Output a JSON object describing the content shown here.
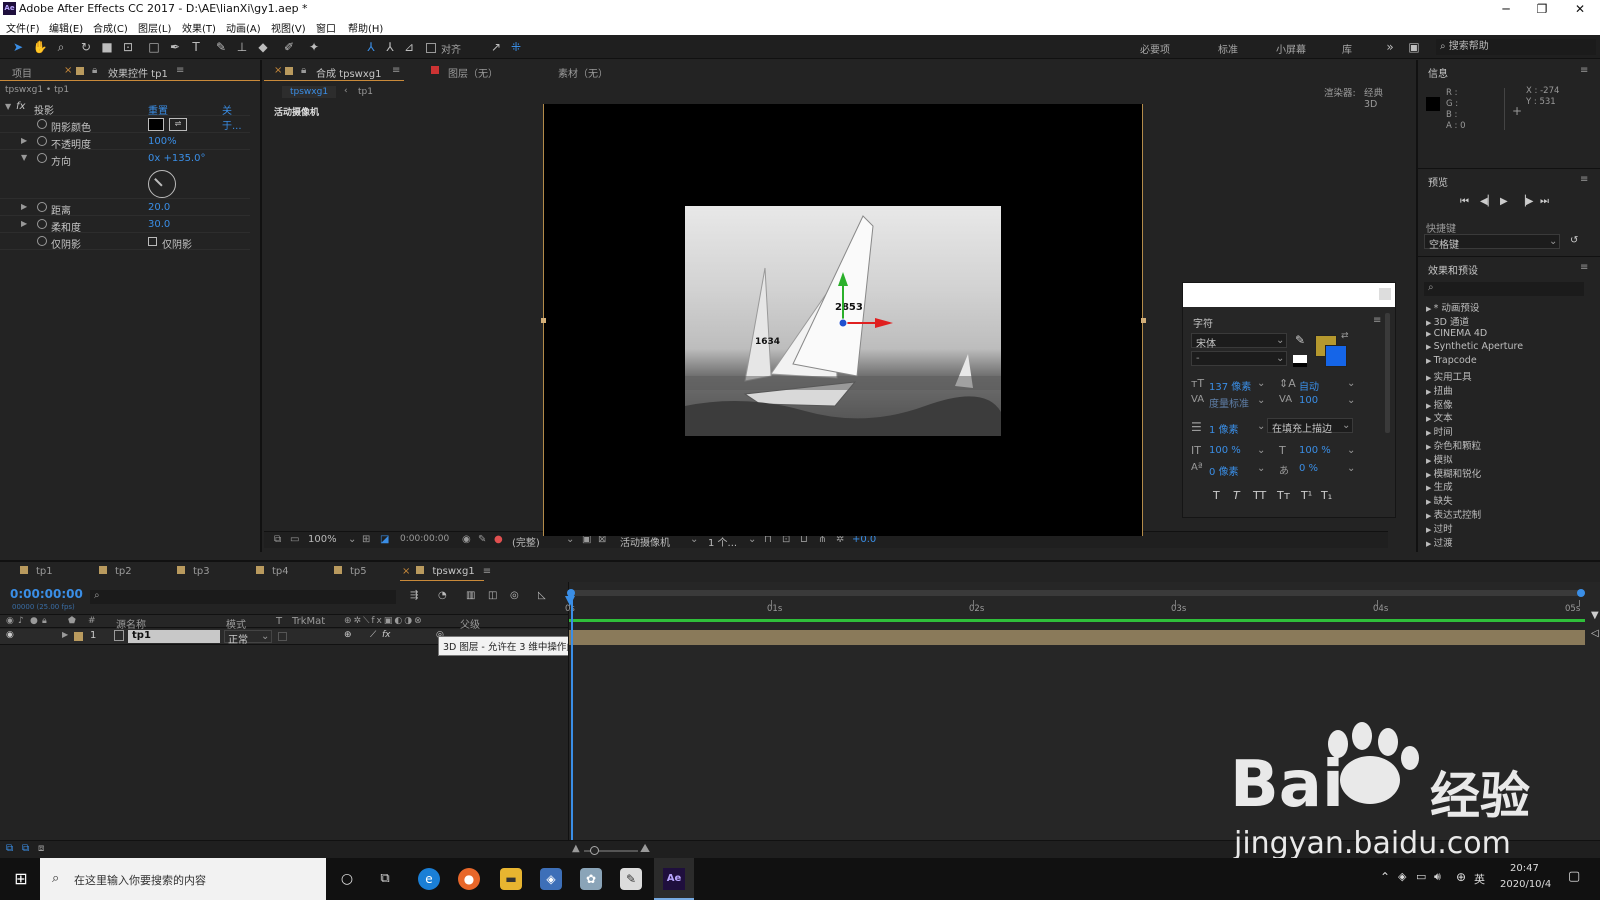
{
  "window": {
    "title": "Adobe After Effects CC 2017 - D:\\AE\\lianXi\\gy1.aep *",
    "logo": "Ae"
  },
  "menu": [
    "文件(F)",
    "编辑(E)",
    "合成(C)",
    "图层(L)",
    "效果(T)",
    "动画(A)",
    "视图(V)",
    "窗口",
    "帮助(H)"
  ],
  "toolbar": {
    "align_label": "对齐",
    "workspaces": [
      "必要项",
      "标准",
      "小屏幕",
      "库"
    ],
    "search_help": "搜索帮助"
  },
  "left_panel": {
    "tabs": [
      "项目",
      "效果控件 tp1"
    ],
    "breadcrumb": "tpswxg1 • tp1",
    "effect": {
      "name": "投影",
      "reset": "重置",
      "about": "关于..."
    },
    "properties": [
      {
        "name": "阴影颜色",
        "value": ""
      },
      {
        "name": "不透明度",
        "value": "100%"
      },
      {
        "name": "方向",
        "value": "0x +135.0°"
      },
      {
        "name": "距离",
        "value": "20.0"
      },
      {
        "name": "柔和度",
        "value": "30.0"
      },
      {
        "name": "仅阴影",
        "value": "仅阴影"
      }
    ]
  },
  "comp_panel": {
    "tabs": [
      "合成 tpswxg1",
      "图层（无）",
      "素材（无）"
    ],
    "subtabs": [
      "tpswxg1",
      "tp1"
    ],
    "renderer_label": "渲染器:",
    "renderer_value": "经典 3D",
    "camera_label": "活动摄像机",
    "footer": {
      "zoom": "100%",
      "timecode": "0:00:00:00",
      "resolution": "(完整)",
      "camera": "活动摄像机",
      "views": "1 个...",
      "exposure": "+0.0"
    },
    "boat_numbers": [
      "2853",
      "1634"
    ]
  },
  "char_panel": {
    "title": "字符",
    "font": "宋体",
    "font_style": "-",
    "size": "137 像素",
    "leading": "自动",
    "kerning": "度量标准",
    "tracking": "100",
    "stroke": "1 像素",
    "stroke_mode": "在填充上描边",
    "vscale": "100 %",
    "hscale": "100 %",
    "baseline": "0 像素",
    "tsume": "0 %",
    "fill_color": "#b5982e",
    "stroke_color": "#1565e8",
    "styles": [
      "T",
      "T",
      "TT",
      "Tт",
      "T¹",
      "T₁"
    ]
  },
  "right_panel": {
    "info_title": "信息",
    "rgba": [
      "R :",
      "G :",
      "B :",
      "A : 0"
    ],
    "xy": [
      "X : -274",
      "Y : 531"
    ],
    "preview_title": "预览",
    "shortcut_label": "快捷键",
    "shortcut_value": "空格键",
    "effects_title": "效果和预设",
    "effects": [
      "* 动画预设",
      "3D 通道",
      "CINEMA 4D",
      "Synthetic Aperture",
      "Trapcode",
      "实用工具",
      "扭曲",
      "抠像",
      "文本",
      "时间",
      "杂色和颗粒",
      "模拟",
      "模糊和锐化",
      "生成",
      "缺失",
      "表达式控制",
      "过时",
      "过渡"
    ]
  },
  "timeline": {
    "tabs": [
      "tp1",
      "tp2",
      "tp3",
      "tp4",
      "tp5",
      "tpswxg1"
    ],
    "timecode": "0:00:00:00",
    "fps": "00000 (25.00 fps)",
    "ruler": [
      "0s",
      "01s",
      "02s",
      "03s",
      "04s",
      "05s"
    ],
    "columns": [
      "源名称",
      "模式",
      "T",
      "TrkMat",
      "父级"
    ],
    "layer": {
      "num": "1",
      "name": "tp1",
      "mode": "正常"
    },
    "tooltip": "3D 图层 - 允许在 3 维中操作此图层"
  },
  "taskbar": {
    "search_placeholder": "在这里输入你要搜索的内容",
    "ime": "英",
    "time": "20:47",
    "date": "2020/10/4"
  },
  "watermark": {
    "brand": "Bai",
    "cn": "经验",
    "url": "jingyan.baidu.com"
  },
  "colors": {
    "accent": "#3a8ee6",
    "comp_border": "#b38b4a",
    "timeline_bar": "#8a7a5a"
  }
}
